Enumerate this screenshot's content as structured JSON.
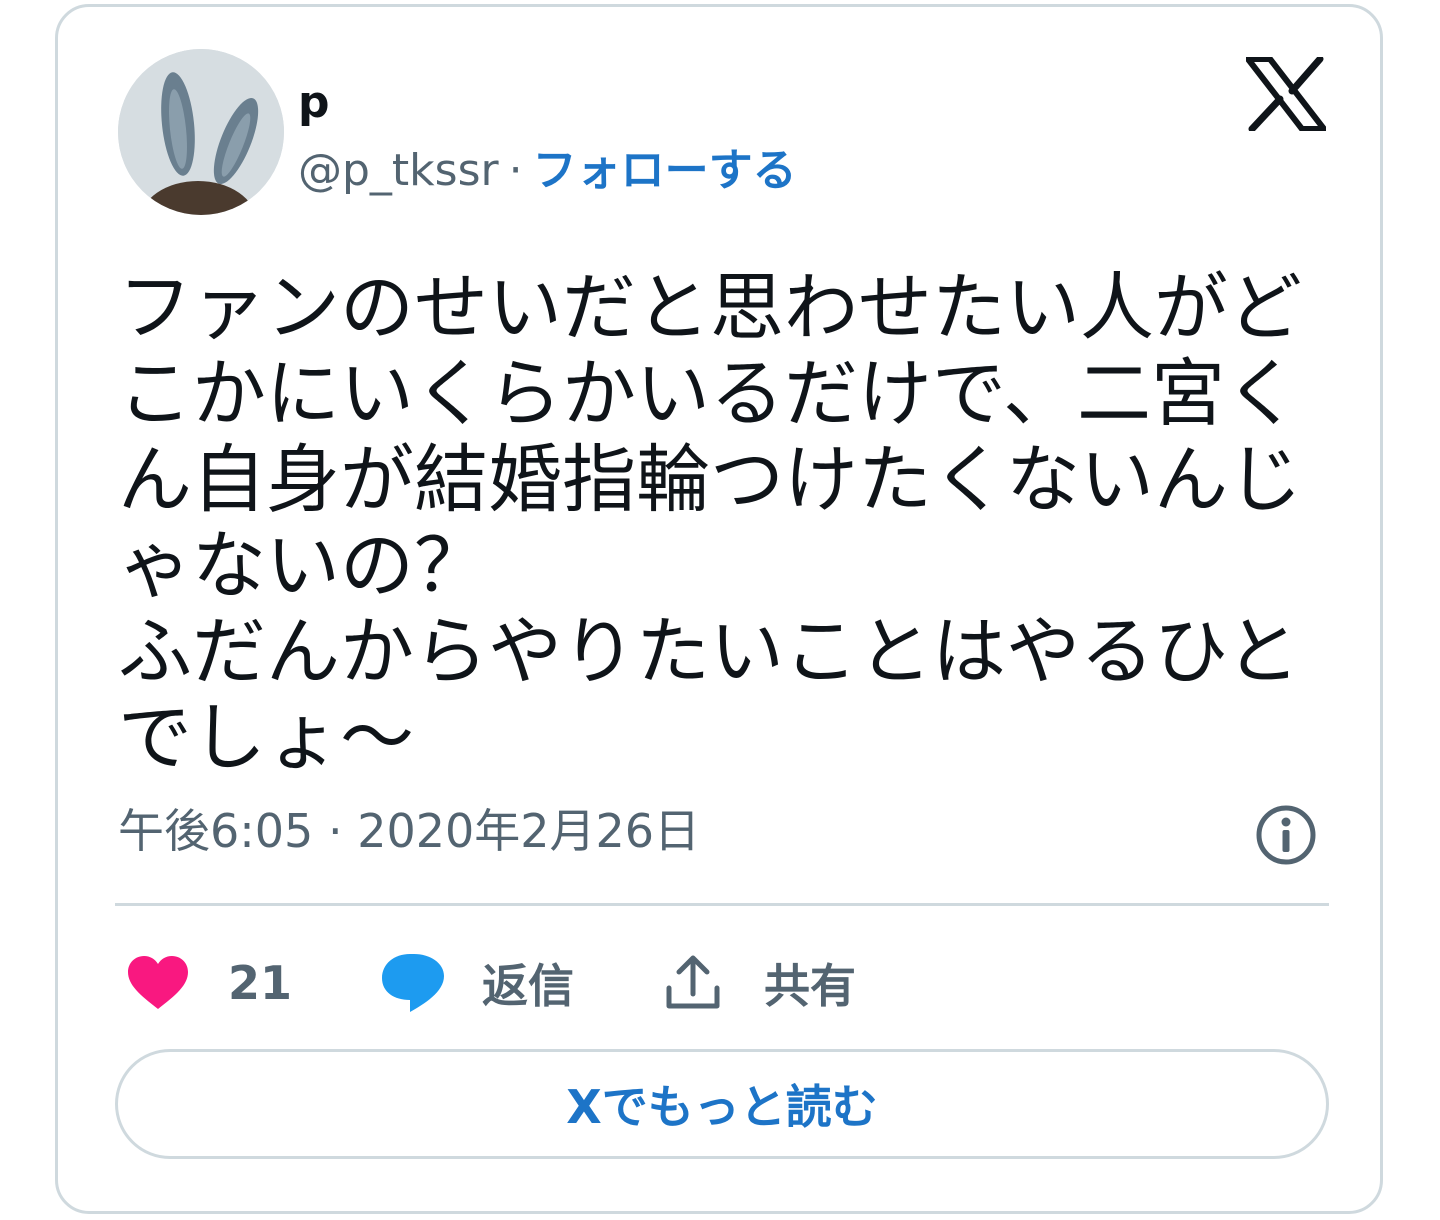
{
  "user": {
    "display_name": "p",
    "handle": "@p_tkssr",
    "separator": "·",
    "follow_label": "フォローする"
  },
  "tweet": {
    "text": "ファンのせいだと思わせたい人がどこかにいくらかいるだけで、二宮くん自身が結婚指輪つけたくないんじゃないの？\nふだんからやりたいことはやるひとでしょ〜",
    "time": "午後6:05",
    "separator": "·",
    "date": "2020年2月26日"
  },
  "actions": {
    "like_count": "21",
    "reply_label": "返信",
    "share_label": "共有"
  },
  "read_more_label": "Xでもっと読む",
  "colors": {
    "link": "#1d74c7",
    "like": "#f91880",
    "reply": "#1d9bf0",
    "muted": "#536471",
    "text": "#0f1419",
    "border": "#cfd9de"
  },
  "icons": {
    "brand": "x-logo-icon",
    "info": "info-icon",
    "like": "heart-icon",
    "reply": "speech-bubble-icon",
    "share": "share-upload-icon"
  }
}
